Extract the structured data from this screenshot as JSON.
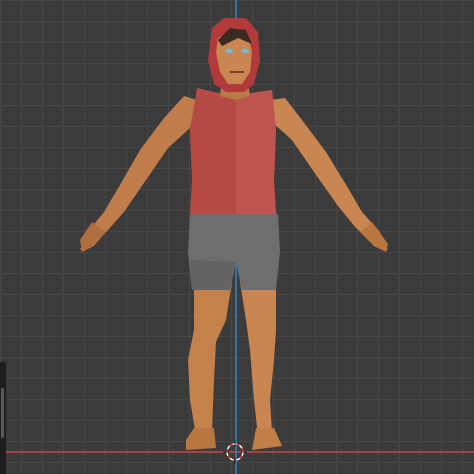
{
  "viewport": {
    "background_color": "#3b3b3b",
    "grid_color": "#474747",
    "x_axis_color": "#c1484f",
    "z_axis_color": "#3d7fc2"
  },
  "model": {
    "hood_color": "#b33a3a",
    "shirt_color": "#b84a46",
    "shorts_color": "#6e6e6e",
    "skin_color": "#c98650"
  },
  "icons": {
    "origin": "3d-cursor-icon"
  }
}
